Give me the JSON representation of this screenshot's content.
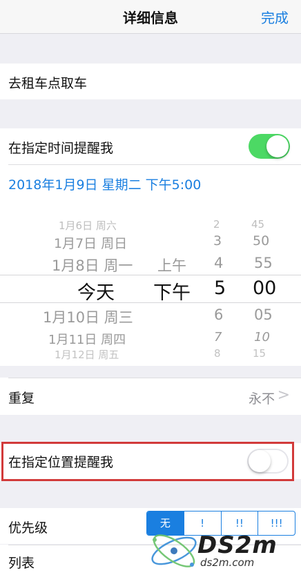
{
  "nav": {
    "title": "详细信息",
    "done": "完成"
  },
  "task": {
    "title": "去租车点取车"
  },
  "remind_time": {
    "label": "在指定时间提醒我",
    "on": true
  },
  "date_line": "2018年1月9日 星期二 下午5:00",
  "picker": {
    "days": [
      "1月6日 周六",
      "1月7日 周日",
      "1月8日 周一",
      "今天",
      "1月10日 周三",
      "1月11日 周四",
      "1月12日 周五"
    ],
    "ampm": [
      "上午",
      "下午"
    ],
    "hours": [
      "2",
      "3",
      "4",
      "5",
      "6",
      "7",
      "8"
    ],
    "minutes": [
      "45",
      "50",
      "55",
      "00",
      "05",
      "10",
      "15"
    ],
    "selected_index": 3
  },
  "repeat": {
    "label": "重复",
    "value": "永不",
    "chevron": ">"
  },
  "remind_location": {
    "label": "在指定位置提醒我",
    "on": false
  },
  "priority": {
    "label": "优先级",
    "options": [
      "无",
      "!",
      "!!",
      "!!!"
    ],
    "selected": "无"
  },
  "list": {
    "label": "列表"
  },
  "watermark": {
    "logo": "DS2m",
    "sub": "ds2m.com"
  },
  "colors": {
    "accent": "#1a7fe0",
    "toggle_on": "#4cd964",
    "highlight": "#d23a3a"
  }
}
